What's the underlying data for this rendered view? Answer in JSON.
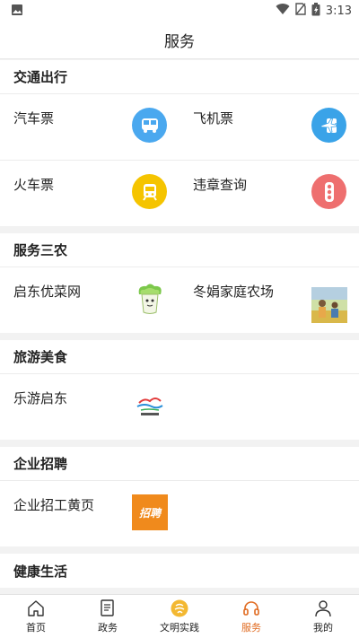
{
  "status_bar": {
    "time": "3:13"
  },
  "header": {
    "title": "服务"
  },
  "sections": [
    {
      "title": "交通出行",
      "items": [
        {
          "label": "汽车票",
          "icon": "bus-icon",
          "color": "#4aa8ef"
        },
        {
          "label": "飞机票",
          "icon": "plane-ticket-icon",
          "color": "#3aa3e8"
        },
        {
          "label": "火车票",
          "icon": "train-icon",
          "color": "#f5c400"
        },
        {
          "label": "违章查询",
          "icon": "traffic-light-icon",
          "color": "#ee6f6f"
        }
      ]
    },
    {
      "title": "服务三农",
      "items": [
        {
          "label": "启东优菜网",
          "icon": "cabbage-icon"
        },
        {
          "label": "冬娟家庭农场",
          "icon": "farm-photo-icon"
        }
      ]
    },
    {
      "title": "旅游美食",
      "items": [
        {
          "label": "乐游启东",
          "icon": "travel-logo-icon"
        }
      ]
    },
    {
      "title": "企业招聘",
      "items": [
        {
          "label": "企业招工黄页",
          "icon": "recruit-poster-icon",
          "poster_text": "招聘"
        }
      ]
    },
    {
      "title": "健康生活"
    }
  ],
  "tabbar": [
    {
      "label": "首页",
      "icon": "home-icon"
    },
    {
      "label": "政务",
      "icon": "document-icon"
    },
    {
      "label": "文明实践",
      "icon": "civilization-logo-icon"
    },
    {
      "label": "服务",
      "icon": "headset-icon",
      "active": true
    },
    {
      "label": "我的",
      "icon": "person-icon"
    }
  ],
  "colors": {
    "accent": "#e06a1f",
    "background": "#f2f2f2"
  }
}
